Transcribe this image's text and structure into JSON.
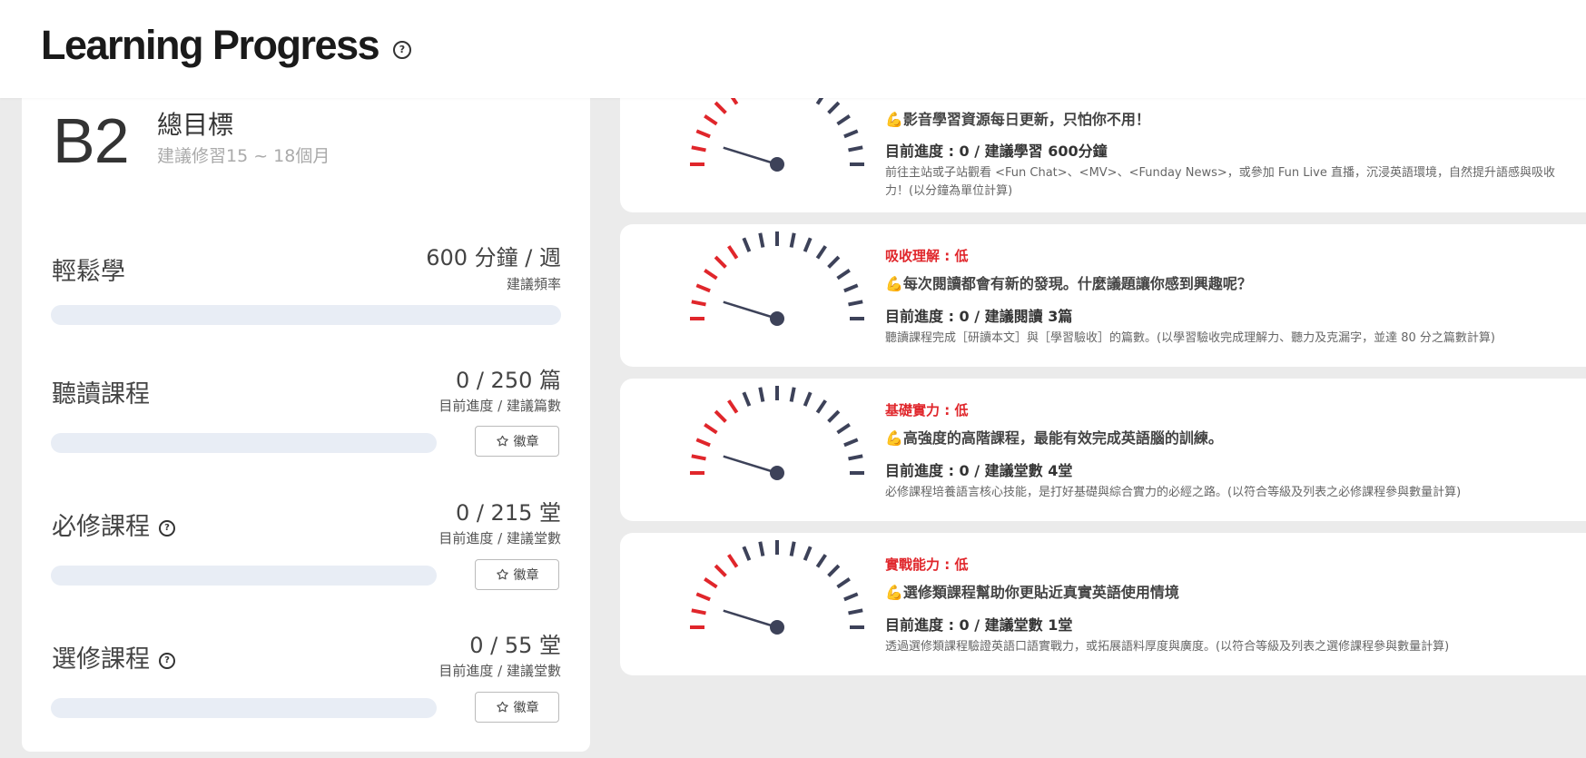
{
  "header": {
    "title": "Learning Progress",
    "help_icon": "question-circle-icon"
  },
  "goal": {
    "level": "B2",
    "title": "總目標",
    "subtitle": "建議修習15 ~ 18個月"
  },
  "sections": [
    {
      "label": "輕鬆學",
      "value": "600 分鐘 / 週",
      "caption": "建議頻率",
      "progress": 0,
      "has_help": false,
      "button": null
    },
    {
      "label": "聽讀課程",
      "value": "0 / 250 篇",
      "caption": "目前進度 / 建議篇數",
      "progress": 0,
      "has_help": false,
      "button": "徽章"
    },
    {
      "label": "必修課程",
      "value": "0 / 215 堂",
      "caption": "目前進度 / 建議堂數",
      "progress": 0,
      "has_help": true,
      "button": "徽章"
    },
    {
      "label": "選修課程",
      "value": "0 / 55 堂",
      "caption": "目前進度 / 建議堂數",
      "progress": 0,
      "has_help": true,
      "button": "徽章"
    }
  ],
  "badge_icon": "badge-icon",
  "gauges": [
    {
      "status": "",
      "slogan": "💪影音學習資源每日更新，只怕你不用！",
      "progress": "目前進度 : 0 / 建議學習 600分鐘",
      "desc": "前往主站或子站觀看 <Fun Chat>、<MV>、<Funday News>，或參加 Fun Live 直播，沉浸英語環境，自然提升語感與吸收力！(以分鐘為單位計算)",
      "level_fraction": 0
    },
    {
      "status": "吸收理解 : 低",
      "slogan": "💪每次閱讀都會有新的發現。什麼議題讓你感到興趣呢？",
      "progress": "目前進度 : 0 / 建議閱讀 3篇",
      "desc": "聽讀課程完成［研讀本文］與［學習驗收］的篇數。(以學習驗收完成理解力、聽力及克漏字，並達 80 分之篇數計算)",
      "level_fraction": 0
    },
    {
      "status": "基礎實力 : 低",
      "slogan": "💪高強度的高階課程，最能有效完成英語腦的訓練。",
      "progress": "目前進度 : 0 / 建議堂數 4堂",
      "desc": "必修課程培養語言核心技能，是打好基礎與綜合實力的必經之路。(以符合等級及列表之必修課程參與數量計算)",
      "level_fraction": 0
    },
    {
      "status": "實戰能力 : 低",
      "slogan": "💪選修類課程幫助你更貼近真實英語使用情境",
      "progress": "目前進度 : 0 / 建議堂數 1堂",
      "desc": "透過選修類課程驗證英語口語實戰力，或拓展語料厚度與廣度。(以符合等級及列表之選修課程參與數量計算)",
      "level_fraction": 0
    }
  ],
  "colors": {
    "gauge_low": "#e0262b",
    "gauge_tick": "#3d4259",
    "needle": "#3d4259",
    "status_red": "#e0262b",
    "bar_track": "#e8edf5"
  }
}
